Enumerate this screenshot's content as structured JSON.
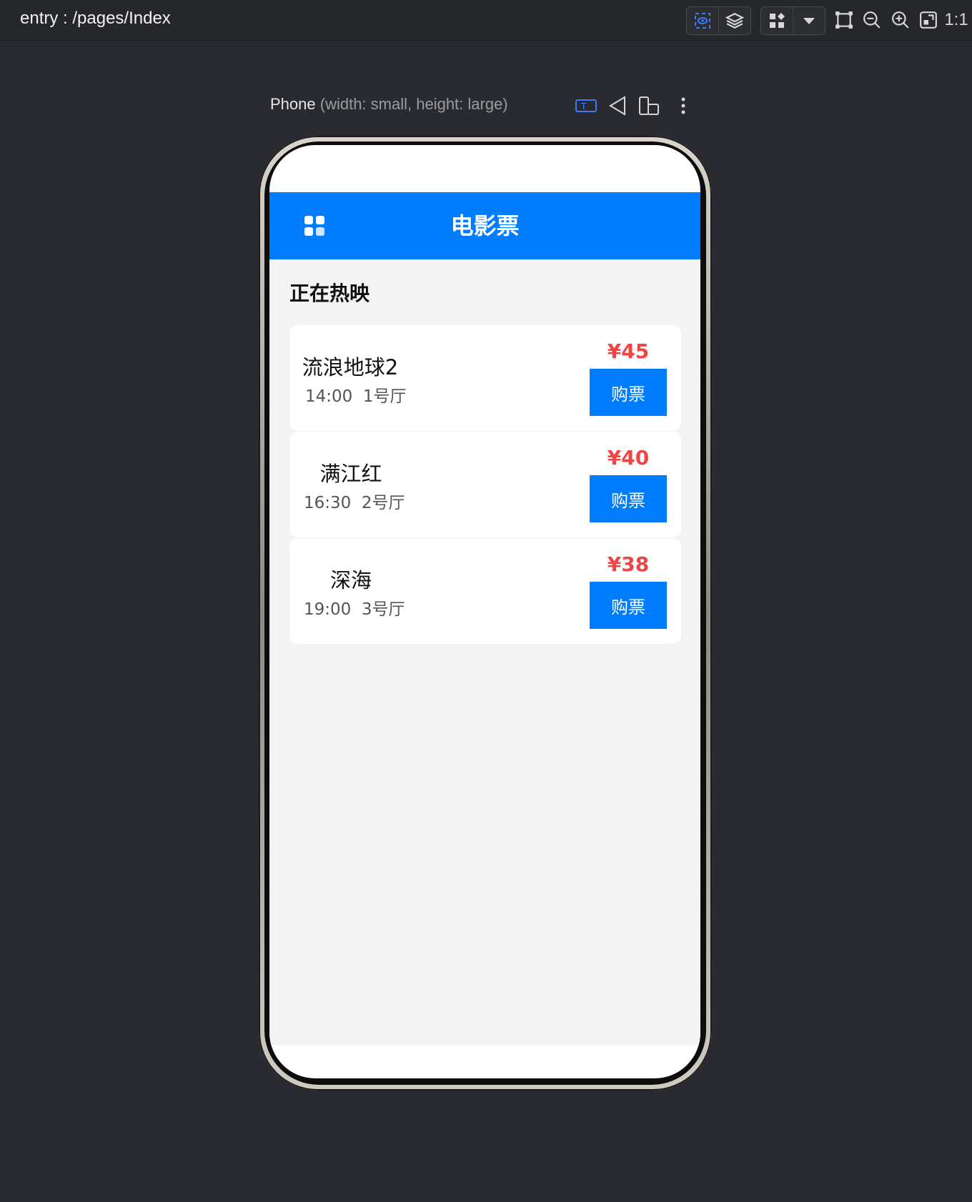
{
  "toolbar": {
    "route_title": "entry : /pages/Index",
    "ratio_label": "1:1",
    "icons": [
      "inspect-icon",
      "layers-icon",
      "components-icon",
      "dropdown-icon",
      "frame-icon",
      "zoom-out-icon",
      "zoom-in-icon",
      "fit-screen-icon"
    ]
  },
  "device": {
    "name": "Phone",
    "size": "(width: small, height: large)",
    "icons": [
      "text-mode-icon",
      "back-icon",
      "rotate-device-icon",
      "more-icon"
    ]
  },
  "app": {
    "header_title": "电影票",
    "section_title": "正在热映",
    "accent_color": "#007dff",
    "price_color": "#f04545",
    "movies": [
      {
        "name": "流浪地球2",
        "info": "14:00  1号厅",
        "price": "¥45",
        "buy_label": "购票"
      },
      {
        "name": "满江红",
        "info": "16:30  2号厅",
        "price": "¥40",
        "buy_label": "购票"
      },
      {
        "name": "深海",
        "info": "19:00  3号厅",
        "price": "¥38",
        "buy_label": "购票"
      }
    ]
  }
}
